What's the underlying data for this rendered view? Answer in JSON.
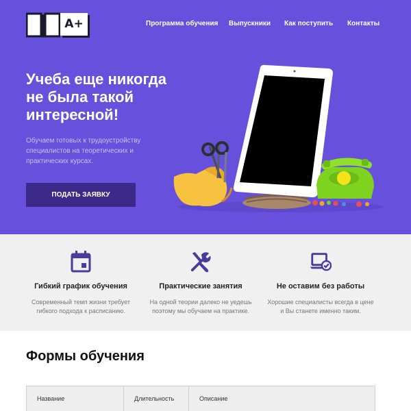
{
  "header": {
    "logo_badge": "A+",
    "nav": [
      "Программа обучения",
      "Выпускники",
      "Как поступить",
      "Контакты"
    ]
  },
  "hero": {
    "title_lines": [
      "Учеба еще никогда",
      "не была такой",
      "интересной!"
    ],
    "subtitle_lines": [
      "Обучаем готовых к трудоустройству",
      "специалистов на теоретических и",
      "практических курсах."
    ],
    "cta_label": "ПОДАТЬ ЗАЯВКУ"
  },
  "features": [
    {
      "icon": "calendar-icon",
      "title": "Гибкий график обучения",
      "desc_lines": [
        "Современный темп жизни требует",
        "гибкого подхода к расписанию."
      ]
    },
    {
      "icon": "tools-icon",
      "title": "Практические занятия",
      "desc_lines": [
        "На одной теории далеко не уедешь",
        "поэтому мы обучаем на практике."
      ]
    },
    {
      "icon": "laptop-check-icon",
      "title": "Не оставим без работы",
      "desc_lines": [
        "Хорошие специалисты всегда в цене",
        "и Вы станете именно таким."
      ]
    }
  ],
  "forms": {
    "title": "Формы обучения",
    "columns": [
      "Название",
      "Длительность",
      "Описание"
    ]
  },
  "colors": {
    "hero_bg": "#6650dc",
    "cta_bg": "#3c2a8a",
    "accent": "#4b3a9e",
    "features_bg": "#f0f0f1"
  }
}
